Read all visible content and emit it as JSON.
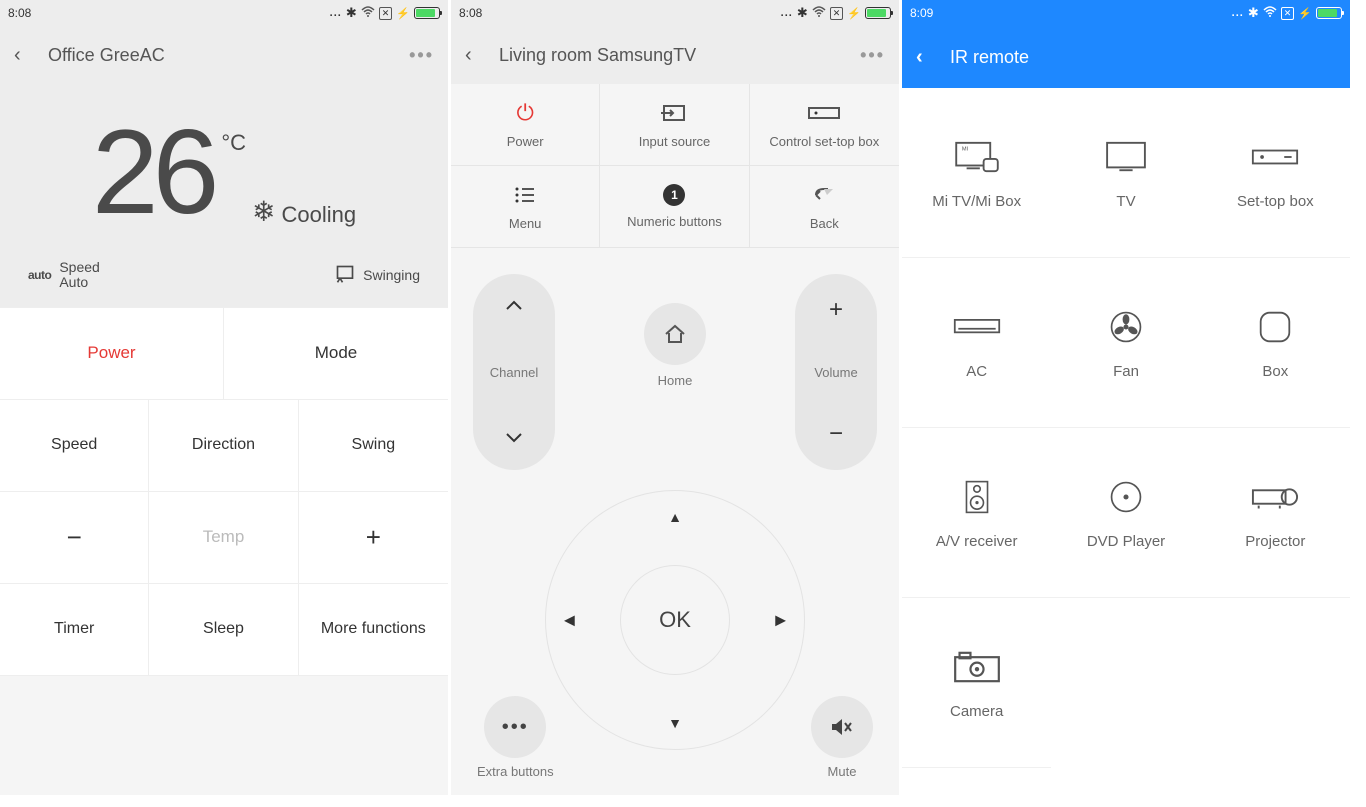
{
  "phone1": {
    "status": {
      "time": "8:08"
    },
    "header": {
      "title": "Office GreeAC"
    },
    "display": {
      "temp": "26",
      "unit": "°C",
      "mode_label": "Cooling",
      "speed_label": "Speed",
      "speed_value": "Auto",
      "auto_badge": "auto",
      "swing_label": "Swinging"
    },
    "buttons": {
      "power": "Power",
      "mode": "Mode",
      "speed": "Speed",
      "direction": "Direction",
      "swing": "Swing",
      "temp": "Temp",
      "minus": "−",
      "plus": "+",
      "timer": "Timer",
      "sleep": "Sleep",
      "more": "More functions"
    }
  },
  "phone2": {
    "status": {
      "time": "8:08"
    },
    "header": {
      "title": "Living room SamsungTV"
    },
    "topgrid": {
      "power": "Power",
      "input": "Input source",
      "stb": "Control set-top box",
      "menu": "Menu",
      "numeric": "Numeric buttons",
      "numeric_badge": "1",
      "back": "Back"
    },
    "mid": {
      "channel": "Channel",
      "home": "Home",
      "volume": "Volume",
      "ok": "OK"
    },
    "bottom": {
      "extra": "Extra buttons",
      "mute": "Mute"
    }
  },
  "phone3": {
    "status": {
      "time": "8:09"
    },
    "header": {
      "title": "IR remote"
    },
    "devices": {
      "mitv": "Mi TV/Mi Box",
      "tv": "TV",
      "stb": "Set-top box",
      "ac": "AC",
      "fan": "Fan",
      "box": "Box",
      "av": "A/V receiver",
      "dvd": "DVD Player",
      "projector": "Projector",
      "camera": "Camera"
    }
  }
}
